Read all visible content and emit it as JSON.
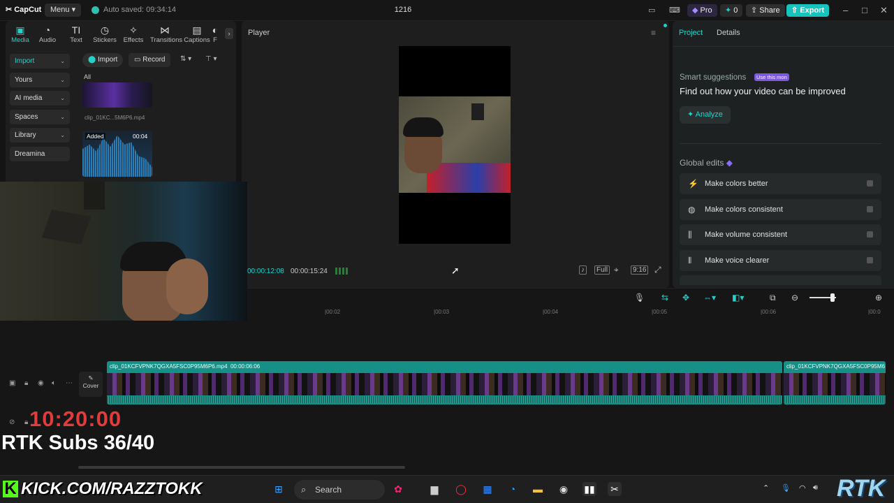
{
  "titlebar": {
    "logo": "CapCut",
    "menu": "Menu",
    "autosave": "Auto saved: 09:34:14",
    "project_title": "1216",
    "pro": "Pro",
    "credits": "0",
    "share": "Share",
    "export": "Export"
  },
  "left_toolbar": [
    {
      "label": "Media",
      "icon": "media-icon"
    },
    {
      "label": "Audio",
      "icon": "audio-icon"
    },
    {
      "label": "Text",
      "icon": "text-icon"
    },
    {
      "label": "Stickers",
      "icon": "stickers-icon"
    },
    {
      "label": "Effects",
      "icon": "effects-icon"
    },
    {
      "label": "Transitions",
      "icon": "transitions-icon"
    },
    {
      "label": "Captions",
      "icon": "captions-icon"
    },
    {
      "label": "F",
      "icon": "filters-icon"
    }
  ],
  "sidebar": [
    "Import",
    "Yours",
    "AI media",
    "Spaces",
    "Library",
    "Dreamina"
  ],
  "media": {
    "import_btn": "Import",
    "record_btn": "Record",
    "filter_all": "All",
    "clip1_name": "clip_01KC...5M6P6.mp4",
    "clip2_badge": "Added",
    "clip2_duration": "00:04"
  },
  "player": {
    "title": "Player",
    "current_time": "00:00:12:08",
    "total_time": "00:00:15:24",
    "full_label": "Full",
    "ratio_label": "9:16"
  },
  "right_panel": {
    "tab_project": "Project",
    "tab_details": "Details",
    "smart_title": "Smart suggestions",
    "smart_badge": "Use this mon",
    "smart_sub": "Find out how your video can be improved",
    "analyze": "Analyze",
    "global_edits": "Global edits",
    "edits": [
      "Make colors better",
      "Make colors consistent",
      "Make volume consistent",
      "Make voice clearer"
    ]
  },
  "timeline": {
    "ruler": [
      "00:02",
      "00:03",
      "00:04",
      "00:05",
      "00:06",
      "00:0"
    ],
    "clip_main_name": "clip_01KCFVPNK7QGXA5FSC0P95M6P6.mp4",
    "clip_main_duration": "00:00:06:06",
    "clip_second_name": "clip_01KCFVPNK7QGXA5FSC0P95M6",
    "cover": "Cover"
  },
  "overlay": {
    "clock": "10:20:00",
    "subs": "RTK Subs 36/40",
    "kick_url": "KICK.COM/RAZZTOKK",
    "rtk_logo": "RTK"
  },
  "taskbar": {
    "search": "Search"
  },
  "colors": {
    "accent": "#26d0c9",
    "export": "#17c3bd",
    "clip": "#168f86",
    "clock": "#e23b3b"
  }
}
